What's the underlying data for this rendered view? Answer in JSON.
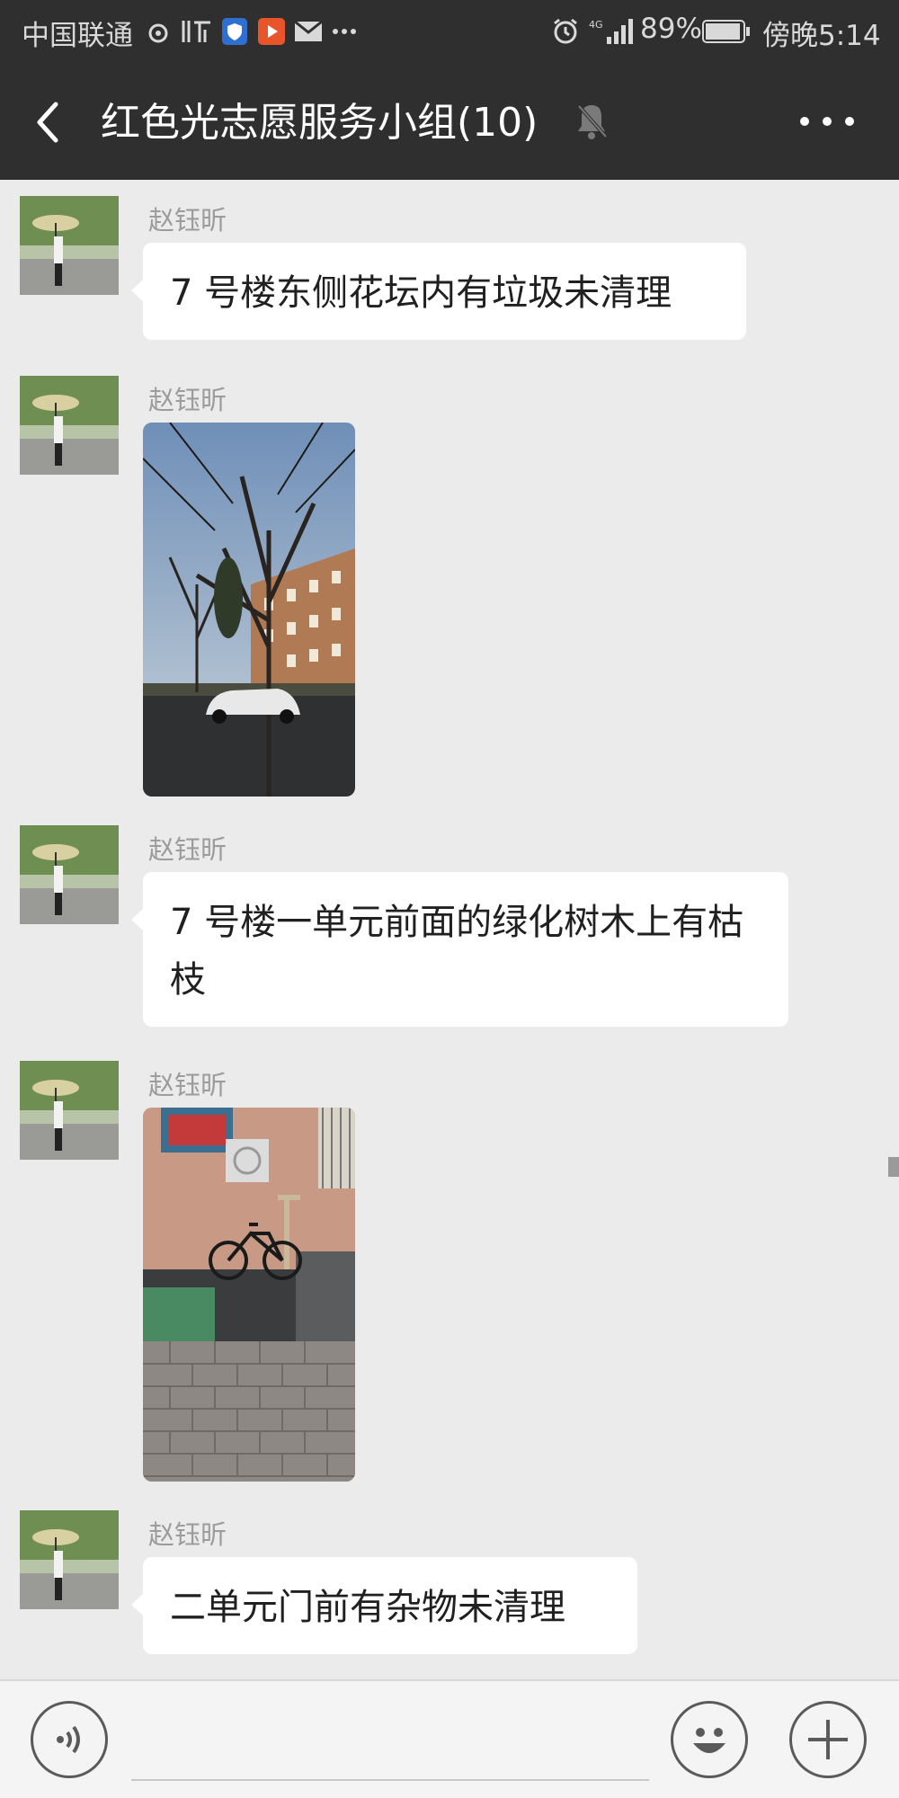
{
  "status_bar": {
    "carrier": "中国联通",
    "icons": [
      "weibo-icon",
      "ting-icon",
      "shield-app-icon",
      "video-app-icon",
      "mail-icon",
      "more-dots-icon",
      "alarm-icon",
      "signal-4g-icon",
      "battery-icon"
    ],
    "battery": "89%",
    "time": "傍晚5:14"
  },
  "header": {
    "title": "红色光志愿服务小组(10)",
    "back_icon": "back-chevron-icon",
    "mute_icon": "muted-bell-icon",
    "more_icon": "more-icon"
  },
  "messages": [
    {
      "sender": "赵钰昕",
      "type": "text",
      "text": "7 号楼东侧花坛内有垃圾未清理"
    },
    {
      "sender": "赵钰昕",
      "type": "image",
      "image": "photo-trees-building-car"
    },
    {
      "sender": "赵钰昕",
      "type": "text",
      "text": "7 号楼一单元前面的绿化树木上有枯枝"
    },
    {
      "sender": "赵钰昕",
      "type": "image",
      "image": "photo-bicycle-doorway"
    },
    {
      "sender": "赵钰昕",
      "type": "text",
      "text": "二单元门前有杂物未清理"
    }
  ],
  "input_bar": {
    "voice_icon": "voice-icon",
    "emoji_icon": "emoji-icon",
    "plus_icon": "plus-icon"
  },
  "colors": {
    "header_bg": "#2f2f2f",
    "chat_bg": "#ebebeb",
    "bubble_bg": "#ffffff"
  }
}
